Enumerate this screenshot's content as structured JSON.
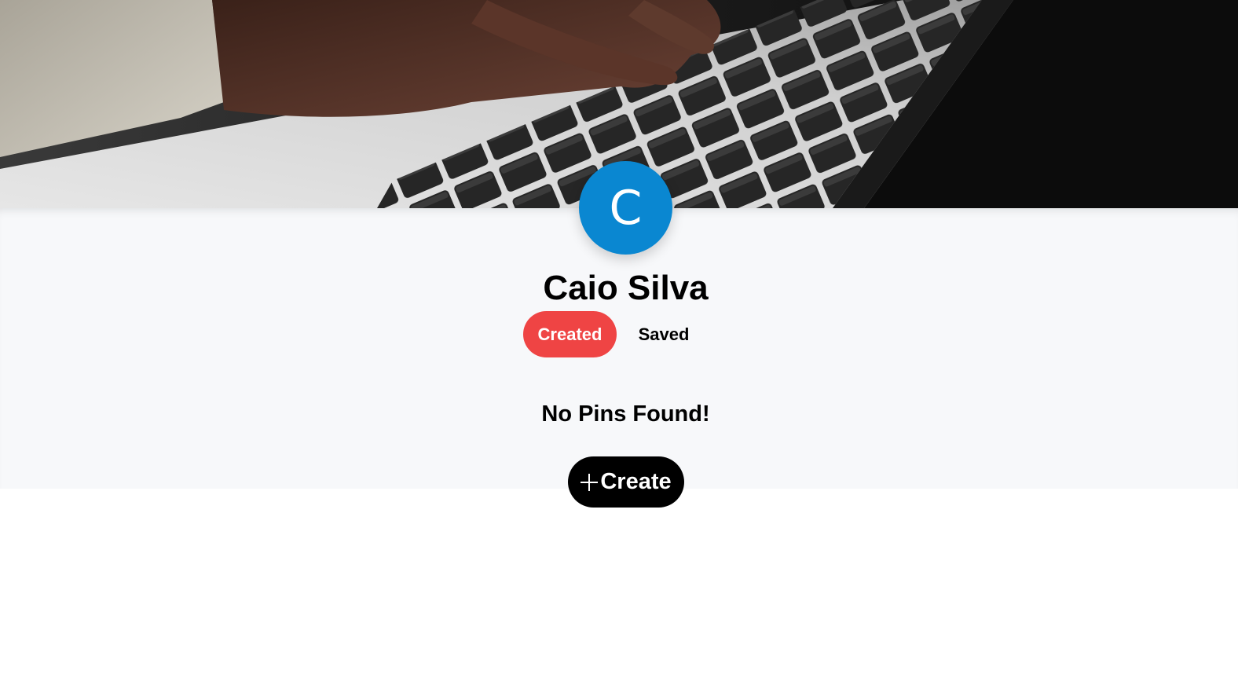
{
  "banner": {
    "image_description": "",
    "colors": {
      "dark": "#0d0d0d",
      "laptop_body": "#d9d9d9",
      "key": "#2a2a2a",
      "skin": "#4a2c22",
      "sleeve": "#b8b3a8"
    }
  },
  "profile": {
    "avatar_initial": "C",
    "avatar_color": "#0a87d1",
    "name": "Caio Silva"
  },
  "tabs": {
    "created_label": "Created",
    "saved_label": "Saved",
    "active": "created",
    "active_color": "#ef4444"
  },
  "content": {
    "empty_message": "No Pins Found!"
  },
  "actions": {
    "create_label": "Create",
    "create_icon": "plus-icon"
  }
}
